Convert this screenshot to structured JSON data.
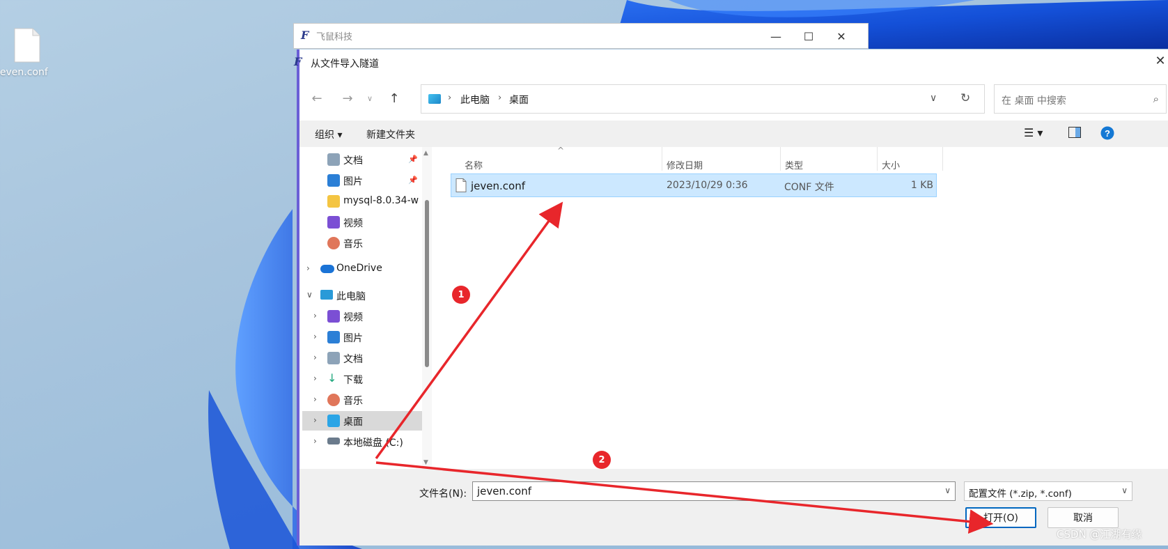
{
  "desktop": {
    "file_label": "jeven.conf"
  },
  "app_window": {
    "title": "飞鼠科技",
    "logo": "F"
  },
  "dialog": {
    "title": "从文件导入隧道",
    "logo": "F",
    "breadcrumb": [
      "此电脑",
      "桌面"
    ],
    "search_placeholder": "在 桌面 中搜索",
    "toolbar": {
      "organize": "组织 ▾",
      "new_folder": "新建文件夹"
    },
    "sidebar": [
      {
        "label": "文档",
        "icon": "document-icon",
        "pinned": true
      },
      {
        "label": "图片",
        "icon": "pictures-icon",
        "pinned": true
      },
      {
        "label": "mysql-8.0.34-w",
        "icon": "folder-icon"
      },
      {
        "label": "视频",
        "icon": "videos-icon"
      },
      {
        "label": "音乐",
        "icon": "music-icon"
      },
      {
        "label": "OneDrive",
        "icon": "onedrive-icon"
      },
      {
        "label": "此电脑",
        "icon": "this-pc-icon"
      },
      {
        "label": "视频",
        "icon": "videos-icon"
      },
      {
        "label": "图片",
        "icon": "pictures-icon"
      },
      {
        "label": "文档",
        "icon": "document-icon"
      },
      {
        "label": "下载",
        "icon": "download-icon"
      },
      {
        "label": "音乐",
        "icon": "music-icon"
      },
      {
        "label": "桌面",
        "icon": "desktop-icon",
        "selected": true
      },
      {
        "label": "本地磁盘 (C:)",
        "icon": "drive-icon"
      }
    ],
    "columns": [
      "名称",
      "修改日期",
      "类型",
      "大小"
    ],
    "files": [
      {
        "name": "jeven.conf",
        "modified": "2023/10/29 0:36",
        "type": "CONF 文件",
        "size": "1 KB"
      }
    ],
    "filename_label": "文件名(N):",
    "filename_value": "jeven.conf",
    "filter_value": "配置文件 (*.zip, *.conf)",
    "open_button": "打开(O)",
    "cancel_button": "取消"
  },
  "annotations": {
    "step1": "1",
    "step2": "2",
    "arrow_color": "#e8262b"
  },
  "watermark": "CSDN @江湖有缘"
}
